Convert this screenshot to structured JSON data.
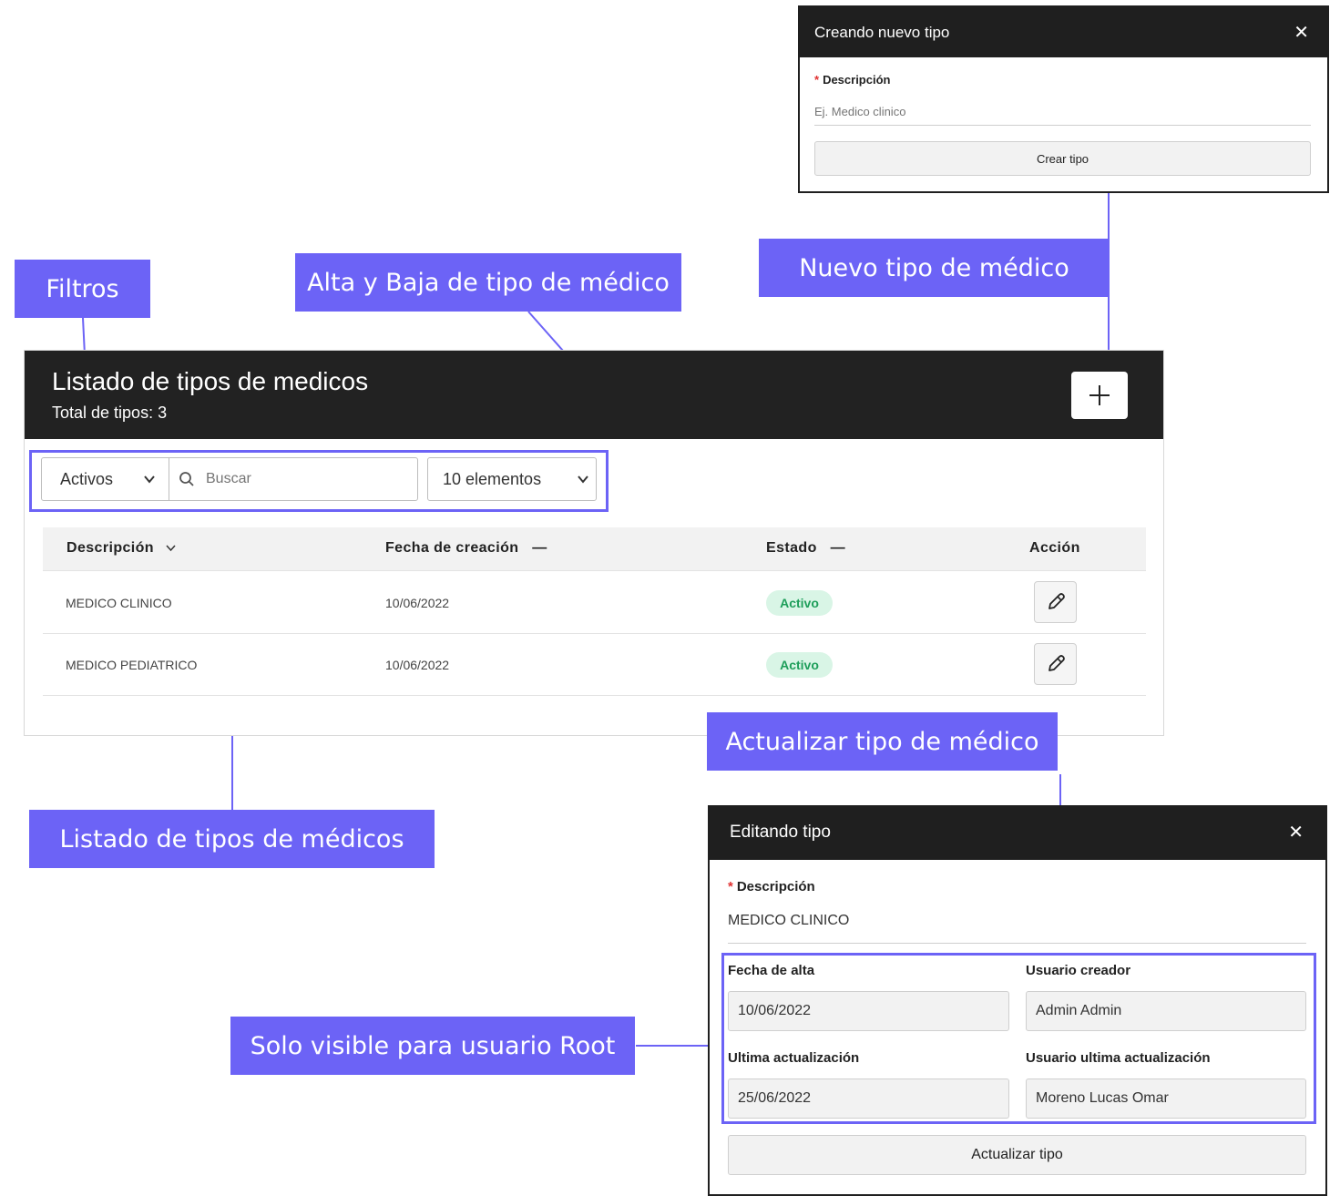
{
  "create_modal": {
    "title": "Creando nuevo tipo",
    "field_label": "Descripción",
    "field_placeholder": "Ej. Medico clinico",
    "submit_label": "Crear tipo"
  },
  "main": {
    "title": "Listado de tipos de medicos",
    "subtitle": "Total de tipos: 3",
    "filters": {
      "status_value": "Activos",
      "search_placeholder": "Buscar",
      "page_size_value": "10 elementos"
    },
    "columns": [
      "Descripción",
      "Fecha de creación",
      "Estado",
      "Acción"
    ],
    "rows": [
      {
        "descripcion": "MEDICO CLINICO",
        "fecha": "10/06/2022",
        "estado": "Activo"
      },
      {
        "descripcion": "MEDICO PEDIATRICO",
        "fecha": "10/06/2022",
        "estado": "Activo"
      }
    ]
  },
  "edit_modal": {
    "title": "Editando tipo",
    "field_label": "Descripción",
    "field_value": "MEDICO CLINICO",
    "fecha_alta_label": "Fecha de alta",
    "fecha_alta_value": "10/06/2022",
    "usuario_creador_label": "Usuario creador",
    "usuario_creador_value": "Admin Admin",
    "ultima_act_label": "Ultima actualización",
    "ultima_act_value": "25/06/2022",
    "usuario_ultima_label": "Usuario ultima actualización",
    "usuario_ultima_value": "Moreno Lucas Omar",
    "submit_label": "Actualizar tipo"
  },
  "callouts": {
    "filtros": "Filtros",
    "alta_baja": "Alta y Baja de tipo de médico",
    "nuevo": "Nuevo tipo de médico",
    "actualizar": "Actualizar tipo de médico",
    "listado": "Listado de tipos de médicos",
    "root": "Solo visible para usuario Root"
  },
  "icons": {
    "close": "close-icon",
    "add": "plus-icon",
    "search": "search-icon",
    "edit": "pencil-icon",
    "chevron": "chevron-down-icon"
  },
  "colors": {
    "accent": "#6c63f6",
    "header_dark": "#222222",
    "badge_bg": "#d9f5e6",
    "badge_text": "#1e9e5a"
  }
}
